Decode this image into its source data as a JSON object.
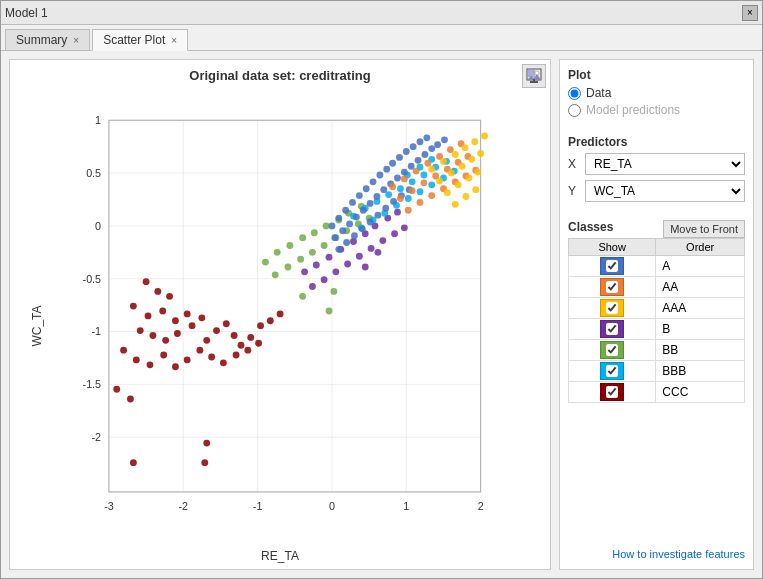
{
  "window": {
    "title": "Model 1",
    "close_icon": "×"
  },
  "tabs": [
    {
      "label": "Summary",
      "active": false,
      "closable": true
    },
    {
      "label": "Scatter Plot",
      "active": true,
      "closable": true
    }
  ],
  "plot": {
    "title": "Original data set: creditrating",
    "x_label": "RE_TA",
    "y_label": "WC_TA",
    "export_icon": "🖼",
    "plot_section": "Plot",
    "radio_data": "Data",
    "radio_model": "Model predictions",
    "predictors_section": "Predictors",
    "x_predictor": "RE_TA",
    "y_predictor": "WC_TA",
    "classes_section": "Classes",
    "move_to_front": "Move to Front",
    "classes_show_col": "Show",
    "classes_order_col": "Order",
    "classes": [
      {
        "name": "A",
        "color": "#4472C4",
        "checked": true
      },
      {
        "name": "AA",
        "color": "#ED7D31",
        "checked": true
      },
      {
        "name": "AAA",
        "color": "#FFC000",
        "checked": true
      },
      {
        "name": "B",
        "color": "#7030A0",
        "checked": true
      },
      {
        "name": "BB",
        "color": "#70AD47",
        "checked": true
      },
      {
        "name": "BBB",
        "color": "#00B0F0",
        "checked": true
      },
      {
        "name": "CCC",
        "color": "#8B0000",
        "checked": true
      }
    ]
  },
  "footer": {
    "help_link": "How to investigate features"
  }
}
